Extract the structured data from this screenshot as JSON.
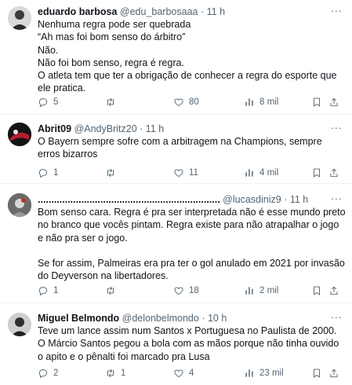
{
  "tweets": [
    {
      "name": "eduardo barbosa",
      "handle": "@edu_barbosaaa",
      "dot": "·",
      "time": "11 h",
      "text": "Nenhuma regra pode ser quebrada\n“Ah mas foi bom senso do árbitro”\nNão.\nNão foi bom senso, regra é regra.\nO atleta tem que ter a obrigação de conhecer a regra do esporte que ele pratica.",
      "replies": "5",
      "retweets": "",
      "likes": "80",
      "views": "8 mil"
    },
    {
      "name": "Abrit09",
      "handle": "@AndyBritz20",
      "dot": "·",
      "time": "11 h",
      "text": "O Bayern sempre sofre com a arbitragem na Champions, sempre erros bizarros",
      "replies": "1",
      "retweets": "",
      "likes": "11",
      "views": "4 mil"
    },
    {
      "name": "...................................................................",
      "handle": "@lucasdiniz9",
      "dot": "·",
      "time": "11 h",
      "text": "Bom senso cara. Regra é pra ser interpretada não é esse mundo preto no branco que vocês pintam. Regra existe para não atrapalhar o jogo e não pra ser o jogo.\n\nSe for assim, Palmeiras era pra ter o gol anulado em 2021 por invasão do Deyverson na libertadores.",
      "replies": "1",
      "retweets": "",
      "likes": "18",
      "views": "2 mil"
    },
    {
      "name": "Miguel Belmondo",
      "handle": "@delonbelmondo",
      "dot": "·",
      "time": "10 h",
      "text": "Teve um lance assim num Santos x Portuguesa no Paulista de 2000. O Márcio Santos pegou a bola com as mãos porque não tinha ouvido o apito e o pênalti foi marcado pra Lusa",
      "replies": "2",
      "retweets": "1",
      "likes": "4",
      "views": "23 mil"
    }
  ],
  "colors": {
    "text": "#0f1419",
    "secondary": "#536471",
    "divider": "#eff3f4"
  },
  "icons": [
    "more-icon",
    "reply-icon",
    "retweet-icon",
    "like-icon",
    "views-icon",
    "bookmark-icon",
    "share-icon"
  ]
}
